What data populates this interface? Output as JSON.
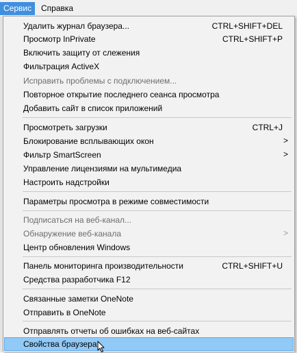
{
  "menubar": {
    "service_label": "Сервис",
    "help_label": "Справка"
  },
  "menu": {
    "delete_history": {
      "label": "Удалить журнал браузера...",
      "shortcut": "CTRL+SHIFT+DEL"
    },
    "inprivate": {
      "label": "Просмотр InPrivate",
      "shortcut": "CTRL+SHIFT+P"
    },
    "tracking_protection": {
      "label": "Включить защиту от слежения"
    },
    "activex_filtering": {
      "label": "Фильтрация ActiveX"
    },
    "fix_connection": {
      "label": "Исправить проблемы с подключением..."
    },
    "reopen_session": {
      "label": "Повторное открытие последнего сеанса просмотра"
    },
    "add_site_apps": {
      "label": "Добавить сайт в список приложений"
    },
    "view_downloads": {
      "label": "Просмотреть загрузки",
      "shortcut": "CTRL+J"
    },
    "popup_blocker": {
      "label": "Блокирование всплывающих окон",
      "arrow": ">"
    },
    "smartscreen": {
      "label": "Фильтр SmartScreen",
      "arrow": ">"
    },
    "media_licenses": {
      "label": "Управление лицензиями на мультимедиа"
    },
    "manage_addons": {
      "label": "Настроить надстройки"
    },
    "compat_view": {
      "label": "Параметры просмотра в режиме совместимости"
    },
    "subscribe_feed": {
      "label": "Подписаться на веб-канал..."
    },
    "feed_discovery": {
      "label": "Обнаружение веб-канала",
      "arrow": ">"
    },
    "windows_update": {
      "label": "Центр обновления Windows"
    },
    "perf_dashboard": {
      "label": "Панель мониторинга производительности",
      "shortcut": "CTRL+SHIFT+U"
    },
    "dev_tools": {
      "label": "Средства разработчика F12"
    },
    "onenote_linked": {
      "label": "Связанные заметки OneNote"
    },
    "send_onenote": {
      "label": "Отправить в OneNote"
    },
    "report_problems": {
      "label": "Отправлять отчеты об ошибках на веб-сайтах"
    },
    "internet_options": {
      "label": "Свойства браузера"
    }
  },
  "colors": {
    "menubar_active_bg": "#3f8fe0",
    "highlight_bg": "#91c9f7",
    "highlight_border": "#62a9e8",
    "disabled_text": "#6d6d6d"
  },
  "icons": {
    "cursor": "mouse-pointer-icon",
    "submenu": "chevron-right-icon"
  }
}
